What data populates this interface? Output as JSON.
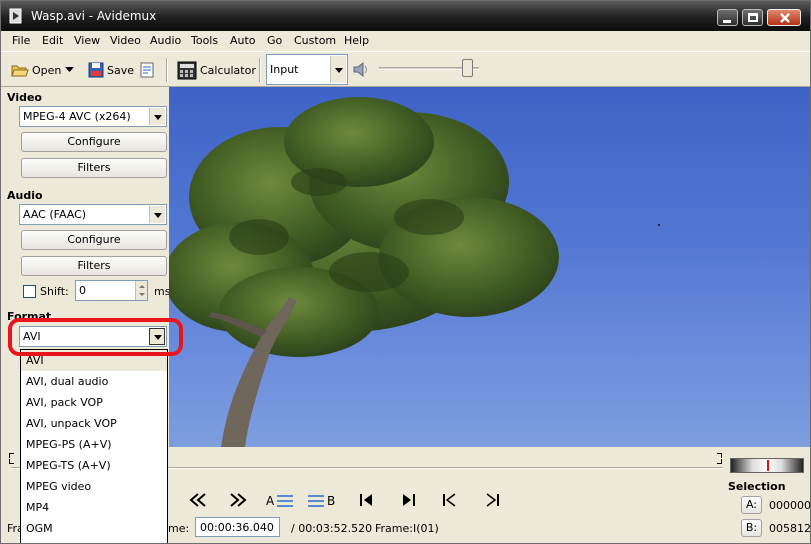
{
  "window": {
    "title": "Wasp.avi - Avidemux"
  },
  "menu": [
    "File",
    "Edit",
    "View",
    "Video",
    "Audio",
    "Tools",
    "Auto",
    "Go",
    "Custom",
    "Help"
  ],
  "toolbar": {
    "open_label": "Open",
    "save_label": "Save",
    "calculator_label": "Calculator",
    "input_combo_value": "Input",
    "volume_level": 0.88
  },
  "video": {
    "section_title": "Video",
    "codec": "MPEG-4 AVC (x264)",
    "configure_label": "Configure",
    "filters_label": "Filters"
  },
  "audio": {
    "section_title": "Audio",
    "codec": "AAC (FAAC)",
    "configure_label": "Configure",
    "filters_label": "Filters",
    "shift_label": "Shift:",
    "shift_value": "0",
    "shift_unit": "ms"
  },
  "format": {
    "section_title": "Format",
    "selected": "AVI",
    "options": [
      "AVI",
      "AVI, dual audio",
      "AVI, pack VOP",
      "AVI, unpack VOP",
      "MPEG-PS (A+V)",
      "MPEG-TS (A+V)",
      "MPEG video",
      "MP4",
      "OGM"
    ]
  },
  "transport": {
    "time_label": "me:",
    "current_time": "00:00:36.040",
    "total_time": "/ 00:03:52.520",
    "frame_info": "Frame:I(01)",
    "frame_left_label": "Fra"
  },
  "selection": {
    "title": "Selection",
    "a_label": "A:",
    "a_value": "000000",
    "b_label": "B:",
    "b_value": "005812"
  },
  "colors": {
    "highlight": "#e8161c",
    "sky": "#4f74d1"
  }
}
